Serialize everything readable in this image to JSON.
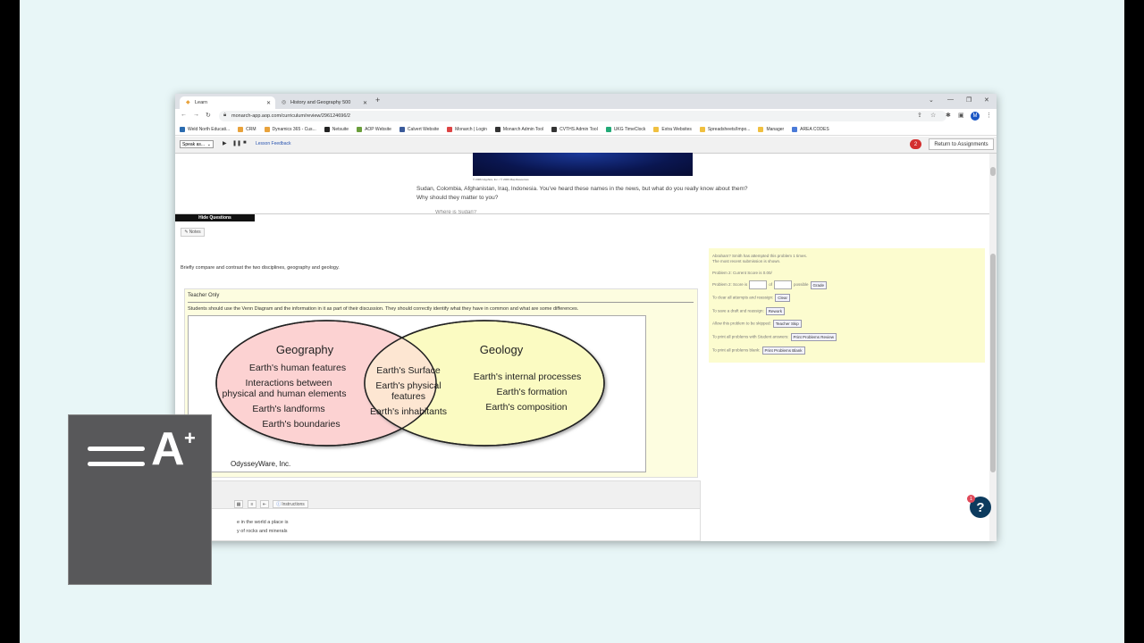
{
  "browser": {
    "tabs": [
      {
        "label": "Learn",
        "active": true
      },
      {
        "label": "History and Geography 500",
        "active": false
      }
    ],
    "url": "monarch-app.aop.com/curriculum/review/296124696/2",
    "profile_initial": "M",
    "bookmarks": [
      {
        "label": "Weld North Educati...",
        "color": "#2b6cb0"
      },
      {
        "label": "CRM",
        "color": "#e8a23b"
      },
      {
        "label": "Dynamics 365 - Cus...",
        "color": "#e8a23b"
      },
      {
        "label": "Netsuite",
        "color": "#222"
      },
      {
        "label": "AOP Website",
        "color": "#6a9e3b"
      },
      {
        "label": "Calvert Website",
        "color": "#3a5a9a"
      },
      {
        "label": "Monarch | Login",
        "color": "#d44"
      },
      {
        "label": "Monarch Admin Tool",
        "color": "#333"
      },
      {
        "label": "CVTHS Admin Tool",
        "color": "#333"
      },
      {
        "label": "UKG TimeClock",
        "color": "#2a7"
      },
      {
        "label": "Extra Websites",
        "color": "#f0c040"
      },
      {
        "label": "Spreadsheets/Impo...",
        "color": "#f0c040"
      },
      {
        "label": "Manager",
        "color": "#f0c040"
      },
      {
        "label": "AREA CODES",
        "color": "#4a7ad8"
      }
    ]
  },
  "lesson_bar": {
    "speak_label": "Speak as...",
    "feedback_label": "Lesson Feedback",
    "badge_count": "2",
    "return_label": "Return to Assignments"
  },
  "content": {
    "image_caption": "© 2006 Glyphics, Inc. / © 2006 Map Resources",
    "paragraph": "Sudan, Colombia, Afghanistan, Iraq, Indonesia. You've heard these names in the news, but what do you really know about them? Why should they matter to you?",
    "cut_line": "Where is Sudan?",
    "hide_questions": "Hide Questions",
    "notes_label": "Notes",
    "question": "Briefly compare and contrast the two disciplines, geography and geology."
  },
  "teacher": {
    "title": "Teacher Only",
    "text": "Students should use the Venn Diagram and the information in it as part of their discussion. They should correctly identify what they have in common and what are some differences."
  },
  "venn": {
    "left_title": "Geography",
    "left_items": [
      "Earth's human features",
      "Interactions between",
      "physical and human elements",
      "Earth's landforms",
      "Earth's boundaries"
    ],
    "center_items": [
      "Earth's Surface",
      "Earth's physical",
      "features",
      "Earth's inhabitants"
    ],
    "right_title": "Geology",
    "right_items": [
      "Earth's internal processes",
      "Earth's formation",
      "Earth's composition"
    ],
    "credit": "OdysseyWare, Inc.",
    "left_color": "#fcd2d2",
    "right_color": "#fbfbc2",
    "overlap_color": "#fde6d2"
  },
  "editor": {
    "instructions_label": "Instructions",
    "line1": "e in the world a place is",
    "line2": "y of rocks and minerals"
  },
  "grading": {
    "attempts": "Abraham? Smith has attempted this problem 1 times.",
    "recent": "The most recent submission is shown.",
    "current_score": "Problem 2: Current Score is 0.00/",
    "score_label": "Problem 2: Score is",
    "of_label": "of",
    "possible_label": "possible",
    "grade_btn": "Grade",
    "clear_text": "To clear all attempts and reassign:",
    "clear_btn": "Clear",
    "rework_text": "To save a draft and reassign:",
    "rework_btn": "Rework",
    "skip_text": "Allow this problem to be skipped:",
    "skip_btn": "Teacher Skip",
    "review_text": "To print all problems with Student answers:",
    "review_btn": "Print Problems Review",
    "blank_text": "To print all problems blank:",
    "blank_btn": "Print Problems Blank"
  },
  "help": {
    "badge": "1",
    "label": "?"
  },
  "overlay": {
    "label": "A",
    "plus": "+"
  }
}
